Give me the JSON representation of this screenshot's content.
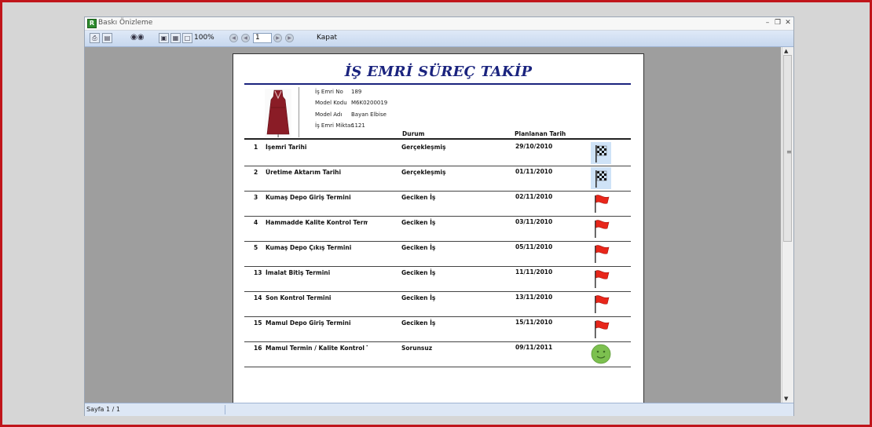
{
  "window": {
    "title": "Baskı Önizleme",
    "app_icon": "app-logo-icon"
  },
  "toolbar": {
    "zoom": "100%",
    "page_number": "1",
    "close_label": "Kapat"
  },
  "status": {
    "page_info": "Sayfa 1 / 1"
  },
  "report": {
    "title": "İŞ EMRİ SÜREÇ TAKİP",
    "info": [
      {
        "label": "İş Emri No",
        "value": "189"
      },
      {
        "label": "Model Kodu",
        "value": "M6K0200019"
      },
      {
        "label": "Model Adı",
        "value": "Bayan Elbise"
      },
      {
        "label": "İş Emri Miktar",
        "value": "1121"
      }
    ],
    "columns": {
      "status": "Durum",
      "planned_date": "Planlanan Tarih"
    },
    "rows": [
      {
        "no": "1",
        "name": "İşemri Tarihi",
        "status": "Gerçekleşmiş",
        "date": "29/10/2010",
        "icon": "checkered-flag"
      },
      {
        "no": "2",
        "name": "Üretime Aktarım Tarihi",
        "status": "Gerçekleşmiş",
        "date": "01/11/2010",
        "icon": "checkered-flag"
      },
      {
        "no": "3",
        "name": "Kumaş Depo Giriş Termini",
        "status": "Geciken İş",
        "date": "02/11/2010",
        "icon": "red-flag"
      },
      {
        "no": "4",
        "name": "Hammadde Kalite Kontrol Termini",
        "status": "Geciken İş",
        "date": "03/11/2010",
        "icon": "red-flag"
      },
      {
        "no": "5",
        "name": "Kumaş Depo Çıkış Termini",
        "status": "Geciken İş",
        "date": "05/11/2010",
        "icon": "red-flag"
      },
      {
        "no": "13",
        "name": "İmalat Bitiş Termini",
        "status": "Geciken İş",
        "date": "11/11/2010",
        "icon": "red-flag"
      },
      {
        "no": "14",
        "name": "Son Kontrol Termini",
        "status": "Geciken İş",
        "date": "13/11/2010",
        "icon": "red-flag"
      },
      {
        "no": "15",
        "name": "Mamul Depo Giriş Termini",
        "status": "Geciken İş",
        "date": "15/11/2010",
        "icon": "red-flag"
      },
      {
        "no": "16",
        "name": "Mamul Termin / Kalite Kontrol Tern",
        "status": "Sorunsuz",
        "date": "09/11/2011",
        "icon": "smiley-face"
      }
    ]
  },
  "colors": {
    "title_blue": "#1a237e",
    "frame_red": "#c0151b",
    "flag_red": "#e8261a",
    "smiley_green": "#7cc04f"
  }
}
